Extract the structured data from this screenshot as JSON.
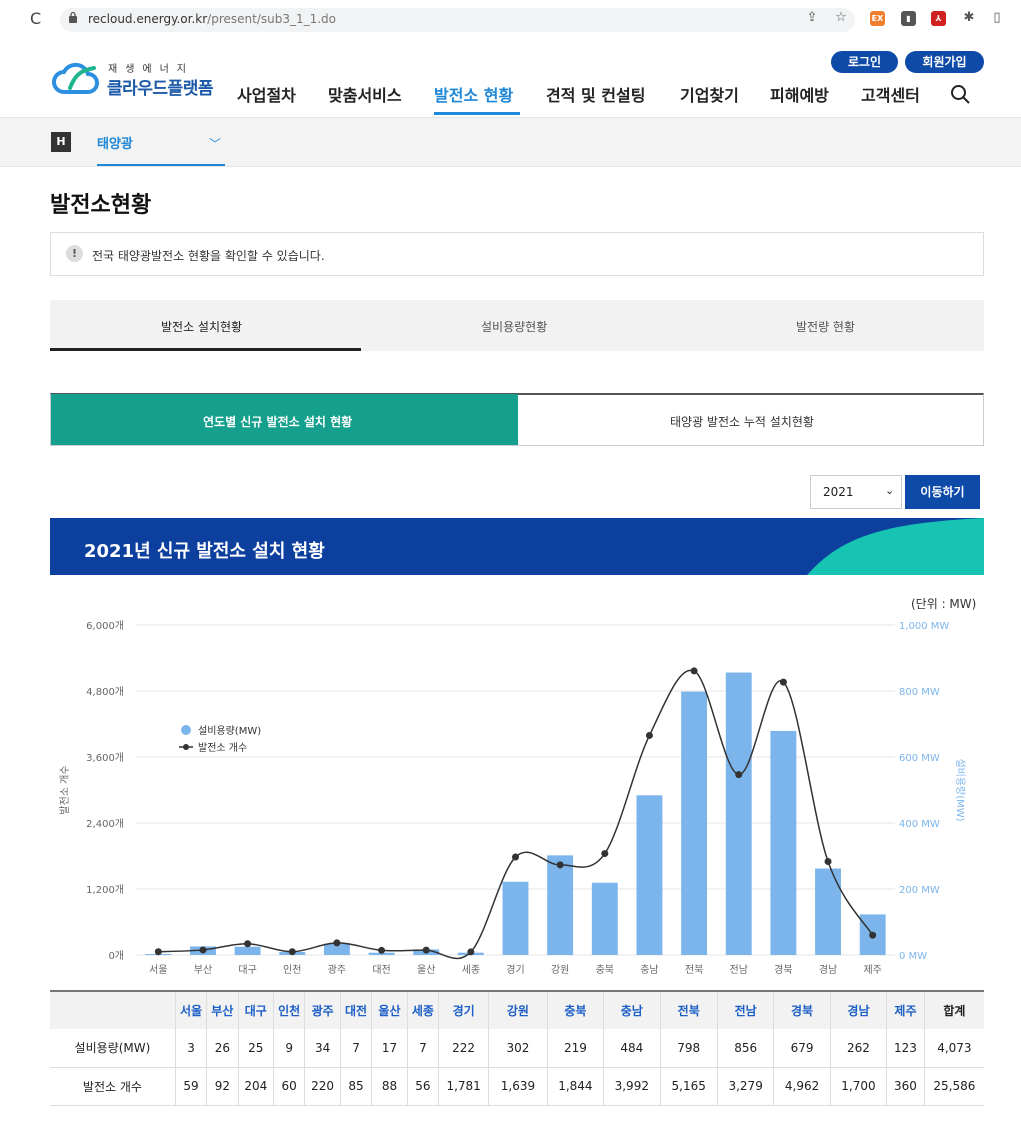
{
  "browser": {
    "url_host": "recloud.energy.or.kr",
    "url_path": "/present/sub3_1_1.do"
  },
  "header": {
    "logo_small": "재생에너지",
    "logo_main": "클라우드플랫폼",
    "login": "로그인",
    "signup": "회원가입",
    "nav": [
      "사업절차",
      "맞춤서비스",
      "발전소 현황",
      "견적 및 컨설팅",
      "기업찾기",
      "피해예방",
      "고객센터"
    ],
    "active_nav": "발전소 현황"
  },
  "subnav": {
    "home": "H",
    "selected": "태양광"
  },
  "page": {
    "title": "발전소현황",
    "info": "전국 태양광발전소 현황을 확인할 수 있습니다.",
    "tabs": [
      "발전소 설치현황",
      "설비용량현황",
      "발전량 현황"
    ],
    "subtabs": [
      "연도별 신규 발전소 설치 현황",
      "태양광 발전소 누적 설치현황"
    ],
    "year": "2021",
    "go_button": "이동하기",
    "banner_title": "2021년 신규 발전소 설치 현황",
    "unit": "(단위 : MW)"
  },
  "colors": {
    "bar": "#7cb5ec",
    "line": "#333333",
    "teal": "#14a08c",
    "navy": "#0c3f9e"
  },
  "chart_data": {
    "type": "bar",
    "categories": [
      "서울",
      "부산",
      "대구",
      "인천",
      "광주",
      "대전",
      "울산",
      "세종",
      "경기",
      "강원",
      "충북",
      "충남",
      "전북",
      "전남",
      "경북",
      "경남",
      "제주"
    ],
    "series": [
      {
        "name": "설비용량(MW)",
        "type": "bar",
        "axis": "right",
        "values": [
          3,
          26,
          25,
          9,
          34,
          7,
          17,
          7,
          222,
          302,
          219,
          484,
          798,
          856,
          679,
          262,
          123
        ]
      },
      {
        "name": "발전소 개수",
        "type": "line",
        "axis": "left",
        "values": [
          59,
          92,
          204,
          60,
          220,
          85,
          88,
          56,
          1781,
          1639,
          1844,
          3992,
          5165,
          3279,
          4962,
          1700,
          360
        ]
      }
    ],
    "ylabel": "발전소 개수",
    "y2label": "설비용량(MW)",
    "ylim": [
      0,
      6000
    ],
    "y2lim": [
      0,
      1000
    ],
    "yticks": [
      "0개",
      "1,200개",
      "2,400개",
      "3,600개",
      "4,800개",
      "6,000개"
    ],
    "y2ticks": [
      "0 MW",
      "200 MW",
      "400 MW",
      "600 MW",
      "800 MW",
      "1,000 MW"
    ],
    "legend": "left-middle",
    "grid": true
  },
  "table": {
    "headers": [
      "",
      "서울",
      "부산",
      "대구",
      "인천",
      "광주",
      "대전",
      "울산",
      "세종",
      "경기",
      "강원",
      "충북",
      "충남",
      "전북",
      "전남",
      "경북",
      "경남",
      "제주",
      "합계"
    ],
    "rows": [
      [
        "설비용량(MW)",
        "3",
        "26",
        "25",
        "9",
        "34",
        "7",
        "17",
        "7",
        "222",
        "302",
        "219",
        "484",
        "798",
        "856",
        "679",
        "262",
        "123",
        "4,073"
      ],
      [
        "발전소 개수",
        "59",
        "92",
        "204",
        "60",
        "220",
        "85",
        "88",
        "56",
        "1,781",
        "1,639",
        "1,844",
        "3,992",
        "5,165",
        "3,279",
        "4,962",
        "1,700",
        "360",
        "25,586"
      ]
    ]
  }
}
